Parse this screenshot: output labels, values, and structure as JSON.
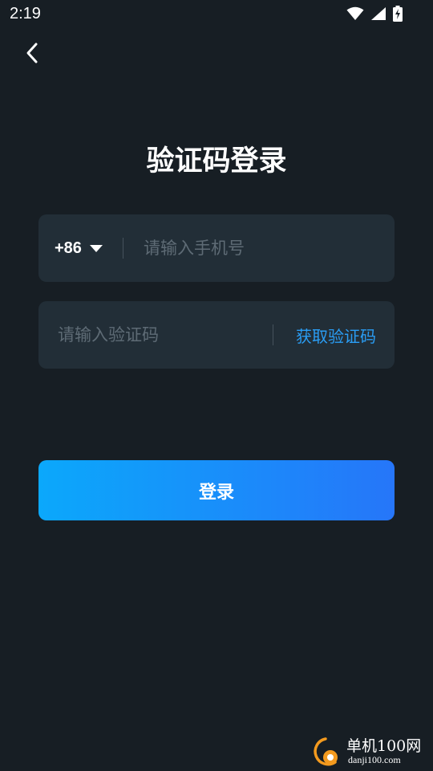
{
  "status_bar": {
    "time": "2:19",
    "icons": [
      "wifi-icon",
      "cellular-signal-icon",
      "battery-charging-icon"
    ]
  },
  "header": {
    "back_icon": "chevron-left-icon"
  },
  "title": "验证码登录",
  "phone_field": {
    "country_code": "+86",
    "dropdown_icon": "caret-down-icon",
    "placeholder": "请输入手机号",
    "value": ""
  },
  "code_field": {
    "placeholder": "请输入验证码",
    "value": "",
    "get_code_label": "获取验证码"
  },
  "login_button_label": "登录",
  "watermark": {
    "title": "单机100网",
    "url": "danji100.com"
  },
  "colors": {
    "background": "#171e24",
    "field_background": "#222e37",
    "accent_link": "#2a9df4",
    "button_gradient_start": "#0ba8fb",
    "button_gradient_end": "#2676f9",
    "placeholder": "#5e6b75",
    "watermark_orange": "#f39a1e"
  }
}
